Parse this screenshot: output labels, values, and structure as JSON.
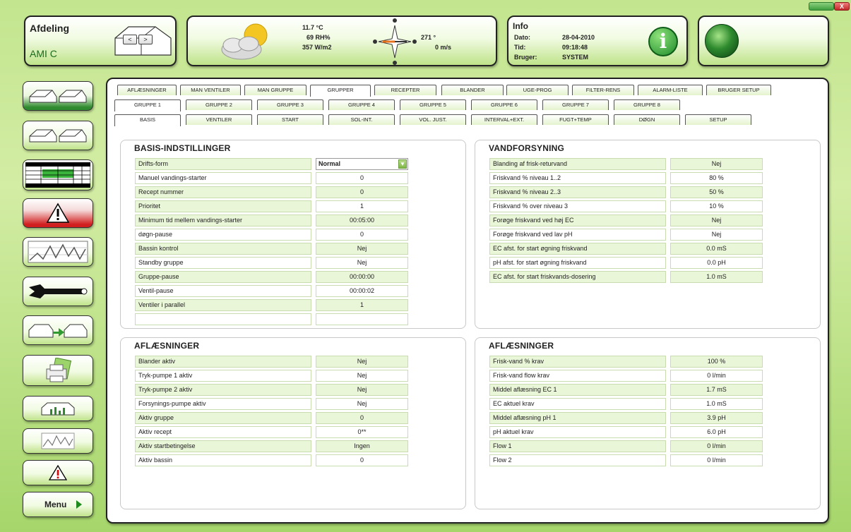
{
  "window": {
    "close_label": "X"
  },
  "afdeling": {
    "title": "Afdeling",
    "value": "AMI C",
    "prev": "<",
    "next": ">"
  },
  "weather": {
    "temp": "11.7 °C",
    "humidity": "69 RH%",
    "radiation": "357 W/m2",
    "wind_dir": "271 °",
    "wind_speed": "0 m/s"
  },
  "info": {
    "title": "Info",
    "fields": [
      {
        "label": "Dato:",
        "value": "28-04-2010"
      },
      {
        "label": "Tid:",
        "value": "09:18:48"
      },
      {
        "label": "Bruger:",
        "value": "SYSTEM"
      }
    ],
    "icon_letter": "i"
  },
  "sidebar": {
    "menu_label": "Menu"
  },
  "tabs_main": [
    "AFLÆSNINGER",
    "MAN VENTILER",
    "MAN GRUPPE",
    "GRUPPER",
    "RECEPTER",
    "BLANDER",
    "UGE-PROG",
    "FILTER-RENS",
    "ALARM-LISTE",
    "BRUGER SETUP"
  ],
  "tabs_group": [
    "GRUPPE 1",
    "GRUPPE 2",
    "GRUPPE 3",
    "GRUPPE 4",
    "GRUPPE 5",
    "GRUPPE 6",
    "GRUPPE 7",
    "GRUPPE 8"
  ],
  "tabs_sub": [
    "BASIS",
    "VENTILER",
    "START",
    "SOL-INT.",
    "VOL. JUST.",
    "INTERVAL+EXT.",
    "FUGT+TEMP",
    "DØGN",
    "SETUP"
  ],
  "basis": {
    "title": "BASIS-INDSTILLINGER",
    "rows": [
      {
        "label": "Drifts-form",
        "value": "Normal"
      },
      {
        "label": "Manuel vandings-starter",
        "value": "0"
      },
      {
        "label": "Recept nummer",
        "value": "0"
      },
      {
        "label": "Prioritet",
        "value": "1"
      },
      {
        "label": "Minimum tid mellem vandings-starter",
        "value": "00:05:00"
      },
      {
        "label": "døgn-pause",
        "value": "0"
      },
      {
        "label": "Bassin kontrol",
        "value": "Nej"
      },
      {
        "label": "Standby gruppe",
        "value": "Nej"
      },
      {
        "label": "Gruppe-pause",
        "value": "00:00:00"
      },
      {
        "label": "Ventil-pause",
        "value": "00:00:02"
      },
      {
        "label": "Ventiler i parallel",
        "value": "1"
      },
      {
        "label": "",
        "value": ""
      }
    ]
  },
  "vand": {
    "title": "VANDFORSYNING",
    "rows": [
      {
        "label": "Blanding af frisk-returvand",
        "value": "Nej"
      },
      {
        "label": "Friskvand % niveau 1..2",
        "value": "80 %"
      },
      {
        "label": "Friskvand % niveau 2..3",
        "value": "50 %"
      },
      {
        "label": "Friskvand % over niveau 3",
        "value": "10 %"
      },
      {
        "label": "Forøge friskvand ved høj EC",
        "value": "Nej"
      },
      {
        "label": "Forøge friskvand ved lav pH",
        "value": "Nej"
      },
      {
        "label": "EC afst. for start øgning friskvand",
        "value": "0.0 mS"
      },
      {
        "label": "pH afst. for start øgning friskvand",
        "value": "0.0 pH"
      },
      {
        "label": "EC afst. for start friskvands-dosering",
        "value": "1.0 mS"
      }
    ]
  },
  "afl_left": {
    "title": "AFLÆSNINGER",
    "rows": [
      {
        "label": "Blander aktiv",
        "value": "Nej"
      },
      {
        "label": "Tryk-pumpe 1 aktiv",
        "value": "Nej"
      },
      {
        "label": "Tryk-pumpe 2 aktiv",
        "value": "Nej"
      },
      {
        "label": "Forsynings-pumpe aktiv",
        "value": "Nej"
      },
      {
        "label": "Aktiv gruppe",
        "value": "0"
      },
      {
        "label": "Aktiv recept",
        "value": "0**"
      },
      {
        "label": "Aktiv startbetingelse",
        "value": "Ingen"
      },
      {
        "label": "Aktiv bassin",
        "value": "0"
      }
    ]
  },
  "afl_right": {
    "title": "AFLÆSNINGER",
    "rows": [
      {
        "label": "Frisk-vand % krav",
        "value": "100 %"
      },
      {
        "label": "Frisk-vand flow krav",
        "value": "0 l/min"
      },
      {
        "label": "Middel aflæsning EC 1",
        "value": "1.7 mS"
      },
      {
        "label": "EC aktuel krav",
        "value": "1.0 mS"
      },
      {
        "label": "Middel aflæsning pH 1",
        "value": "3.9 pH"
      },
      {
        "label": "pH aktuel krav",
        "value": "6.0 pH"
      },
      {
        "label": "Flow 1",
        "value": "0 l/min"
      },
      {
        "label": "Flow 2",
        "value": "0 l/min"
      }
    ]
  }
}
